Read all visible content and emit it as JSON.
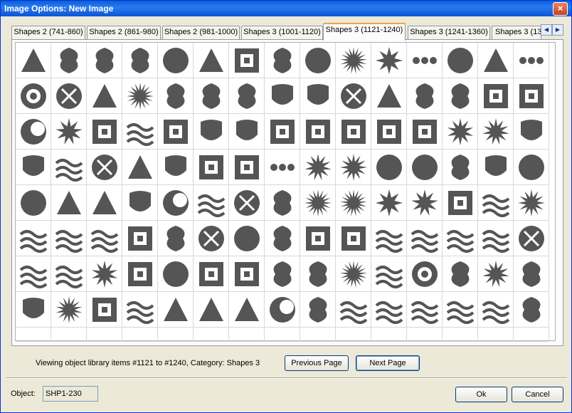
{
  "window": {
    "title": "Image Options: New Image",
    "close_glyph": "×"
  },
  "tabs": [
    {
      "label": "Shapes 2 (741-860)",
      "active": false
    },
    {
      "label": "Shapes 2 (861-980)",
      "active": false
    },
    {
      "label": "Shapes 2 (981-1000)",
      "active": false
    },
    {
      "label": "Shapes 3 (1001-1120)",
      "active": false
    },
    {
      "label": "Shapes 3 (1121-1240)",
      "active": true
    },
    {
      "label": "Shapes 3 (1241-1360)",
      "active": false
    },
    {
      "label": "Shapes 3 (13",
      "active": false
    }
  ],
  "tab_scroll": {
    "left": "◀",
    "right": "▶"
  },
  "grid": {
    "shape_color": "#555555",
    "rows": [
      [
        "triangles-burst",
        "radiation",
        "quad-flower",
        "butterfly",
        "circle-bars",
        "hourglass-bar",
        "square-arrows",
        "l-curve",
        "gear-circle",
        "sun-burst",
        "starburst",
        "three-rings",
        "circle-pyramid",
        "concentric-arcs",
        "three-dots"
      ],
      [
        "bullseye",
        "pinwheel-circle",
        "tall-triangle",
        "compass-sun",
        "crown-spikes",
        "speech-bubble",
        "speech-bubble-2",
        "trapezoid",
        "dome",
        "swirl-tri",
        "bent-triangle",
        "spiral",
        "lens",
        "checker",
        "checker-narrow"
      ],
      [
        "circle-moon",
        "sun-spiky",
        "diamond-squares",
        "zigzag",
        "frame-squares",
        "capsule",
        "bent-cylinder",
        "cross-grid",
        "t-block",
        "square-grid",
        "notched-square",
        "concave-square",
        "four-star",
        "spin-star",
        "arch-door"
      ],
      [
        "arch-gate",
        "squiggle",
        "recycle-circle",
        "scatter-tri",
        "shield-badge",
        "parquet",
        "grid-holes",
        "five-dots",
        "starburst-outline",
        "starburst-solid",
        "gear-outline",
        "three-circles",
        "trefoil",
        "crescent-cap",
        "scalloped-circle"
      ],
      [
        "scalloped-solid",
        "tri-network",
        "tri-dots",
        "pentagon",
        "yin-moon",
        "fan-lines",
        "circle-x",
        "fan-arc",
        "framed-star",
        "star-scatter",
        "framed-compass",
        "compass-star",
        "knot-square",
        "squiggle-line",
        "asterisk-web"
      ],
      [
        "waves-3",
        "waves-3b",
        "waves-outline",
        "knot-frame",
        "angle-bracket",
        "circle-x-solid",
        "wave-circle",
        "hand-leaf",
        "square-cross",
        "z-block",
        "waves-heavy",
        "waves-heavy-2",
        "waves-thin",
        "waves-thin-2",
        "swirl-circle"
      ],
      [
        "line-dash",
        "lightning-line",
        "eight-star",
        "fan-corner",
        "shell",
        "concave-frame",
        "concave-square-2",
        "scribble",
        "splash-flower",
        "ray-burst",
        "tendril",
        "eye-circle",
        "scrolls",
        "sun-rays",
        "lotus"
      ],
      [
        "shield-curve",
        "sun-frame",
        "corner-notch",
        "wave-line",
        "dot-matrix",
        "dot-string",
        "dot-string-2",
        "moon-phases",
        "crescent",
        "swoosh-lines",
        "flick",
        "flick-2",
        "flick-3",
        "flick-4",
        "clover"
      ],
      [
        "",
        "",
        "",
        "",
        "",
        "",
        "",
        "",
        "",
        "",
        "",
        "",
        "",
        "",
        ""
      ]
    ]
  },
  "status_text": "Viewing object library items #1121 to #1240, Category: Shapes 3",
  "buttons": {
    "previous": "Previous Page",
    "next": "Next Page",
    "ok": "Ok",
    "cancel": "Cancel"
  },
  "object_field": {
    "label": "Object:",
    "value": "SHP1-230"
  }
}
